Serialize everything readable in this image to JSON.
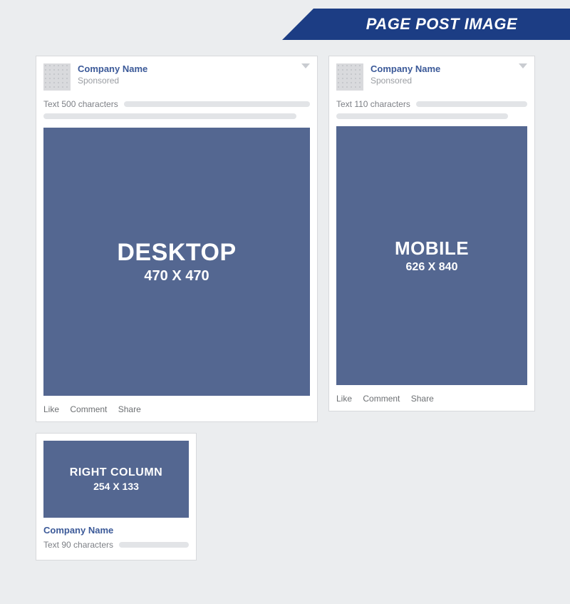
{
  "banner": {
    "title": "PAGE POST IMAGE"
  },
  "actions": {
    "like": "Like",
    "comment": "Comment",
    "share": "Share"
  },
  "desktop": {
    "company": "Company Name",
    "sponsored": "Sponsored",
    "text_label": "Text 500 characters",
    "image_label": "DESKTOP",
    "image_dims": "470 X 470"
  },
  "mobile": {
    "company": "Company Name",
    "sponsored": "Sponsored",
    "text_label": "Text 110 characters",
    "image_label": "MOBILE",
    "image_dims": "626 X 840"
  },
  "right_column": {
    "image_label": "RIGHT COLUMN",
    "image_dims": "254 X 133",
    "company": "Company Name",
    "text_label": "Text 90 characters"
  }
}
